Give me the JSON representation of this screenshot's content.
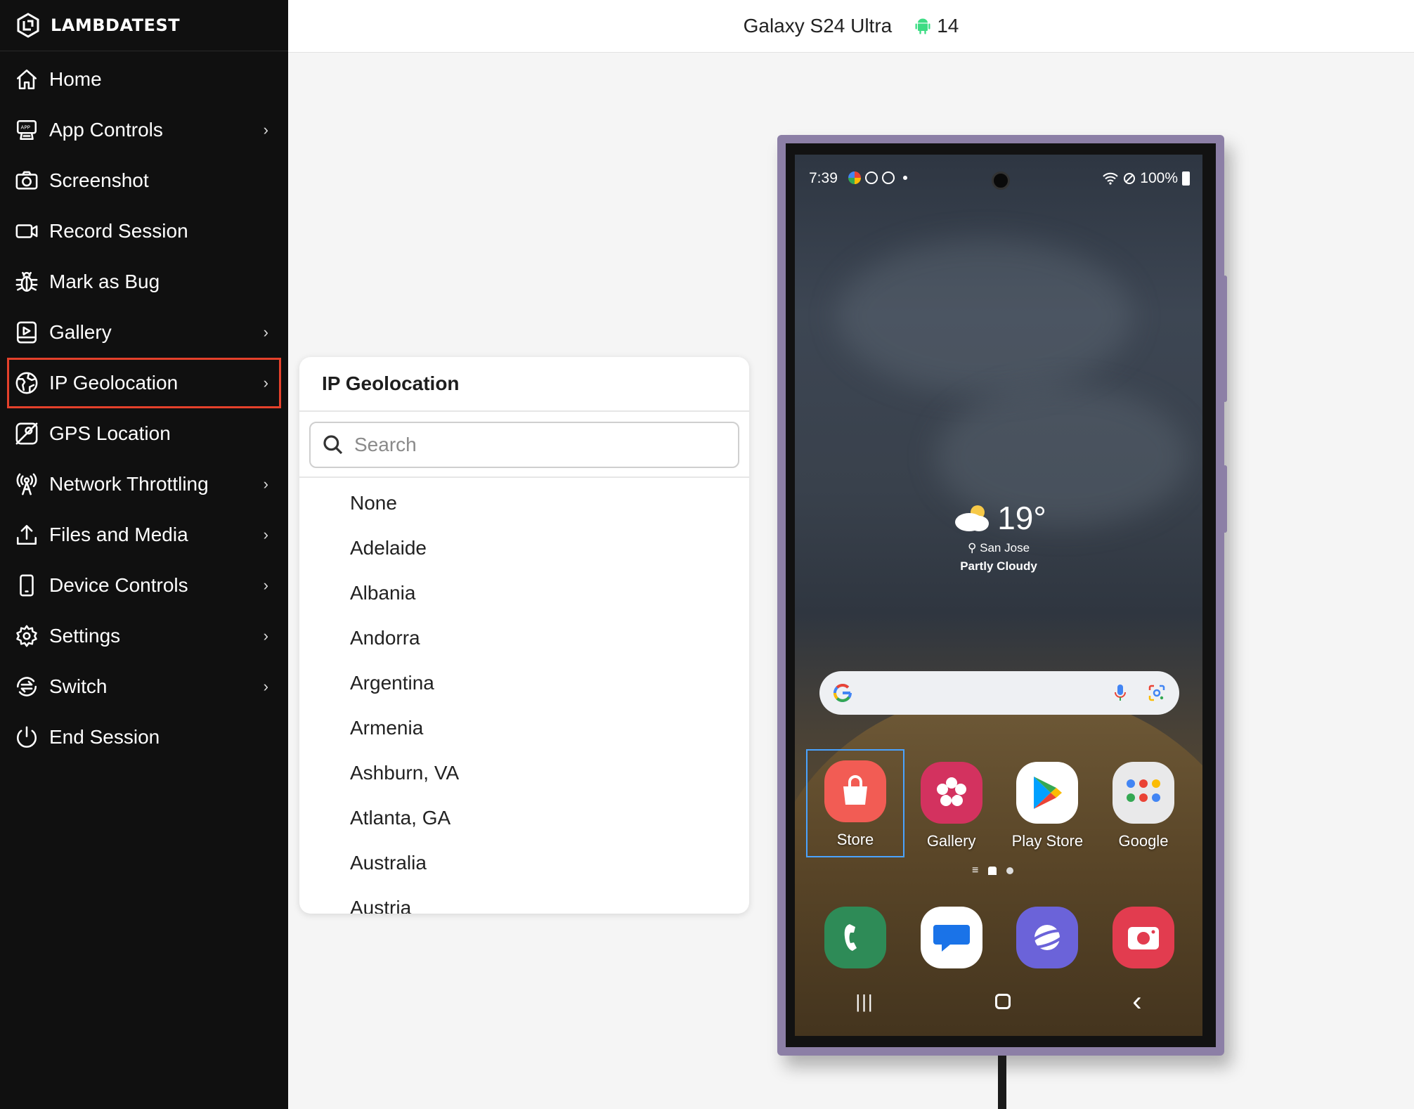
{
  "brand": {
    "name": "LAMBDATEST"
  },
  "sidebar": {
    "items": [
      {
        "label": "Home",
        "icon": "home-icon",
        "has_submenu": false
      },
      {
        "label": "App Controls",
        "icon": "app-controls-icon",
        "has_submenu": true
      },
      {
        "label": "Screenshot",
        "icon": "camera-icon",
        "has_submenu": false
      },
      {
        "label": "Record Session",
        "icon": "video-icon",
        "has_submenu": false
      },
      {
        "label": "Mark as Bug",
        "icon": "bug-icon",
        "has_submenu": false
      },
      {
        "label": "Gallery",
        "icon": "gallery-icon",
        "has_submenu": true
      },
      {
        "label": "IP Geolocation",
        "icon": "globe-icon",
        "has_submenu": true,
        "active": true
      },
      {
        "label": "GPS Location",
        "icon": "map-pin-icon",
        "has_submenu": false
      },
      {
        "label": "Network Throttling",
        "icon": "antenna-icon",
        "has_submenu": true
      },
      {
        "label": "Files and Media",
        "icon": "upload-icon",
        "has_submenu": true
      },
      {
        "label": "Device Controls",
        "icon": "device-icon",
        "has_submenu": true
      },
      {
        "label": "Settings",
        "icon": "gear-icon",
        "has_submenu": true
      },
      {
        "label": "Switch",
        "icon": "switch-icon",
        "has_submenu": true
      },
      {
        "label": "End Session",
        "icon": "power-icon",
        "has_submenu": false
      }
    ],
    "chevron": "›",
    "active_outline_color": "#e5412b"
  },
  "topbar": {
    "device": "Galaxy S24 Ultra",
    "os_version": "14",
    "os_icon": "android-icon"
  },
  "geo_panel": {
    "title": "IP Geolocation",
    "search_placeholder": "Search",
    "locations": [
      "None",
      "Adelaide",
      "Albania",
      "Andorra",
      "Argentina",
      "Armenia",
      "Ashburn, VA",
      "Atlanta, GA",
      "Australia",
      "Austria"
    ]
  },
  "phone": {
    "status": {
      "time": "7:39",
      "battery": "100%"
    },
    "weather": {
      "temp": "19°",
      "location": "San Jose",
      "condition": "Partly Cloudy"
    },
    "apps_row1": [
      {
        "label": "Store",
        "icon": "shopping-bag-icon",
        "color": "#f25c54"
      },
      {
        "label": "Gallery",
        "icon": "flower-icon",
        "color": "#d3325f"
      },
      {
        "label": "Play Store",
        "icon": "play-store-icon",
        "color": "#ffffff"
      },
      {
        "label": "Google",
        "icon": "google-folder-icon",
        "color": "#e9e9ea"
      }
    ],
    "dock": [
      {
        "name": "phone",
        "icon": "phone-icon",
        "color": "#2e8b57"
      },
      {
        "name": "messages",
        "icon": "messages-icon",
        "color": "#ffffff"
      },
      {
        "name": "internet",
        "icon": "internet-icon",
        "color": "#6b63d9"
      },
      {
        "name": "camera",
        "icon": "camera-app-icon",
        "color": "#e23c4f"
      }
    ],
    "nav": {
      "recents": "|||",
      "home": "○",
      "back": "‹"
    }
  }
}
